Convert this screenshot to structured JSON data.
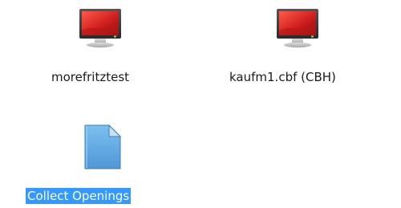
{
  "desktop": {
    "items": [
      {
        "label": "morefritztest",
        "icon": "computer-monitor-icon",
        "selected": false
      },
      {
        "label": "kaufm1.cbf (CBH)",
        "icon": "computer-monitor-icon",
        "selected": false
      },
      {
        "label": "Collect Openings",
        "icon": "document-file-icon",
        "selected": true
      }
    ]
  },
  "colors": {
    "selection": "#3399ff",
    "screen_red": "#d21f1f",
    "file_blue": "#6aaee8"
  }
}
